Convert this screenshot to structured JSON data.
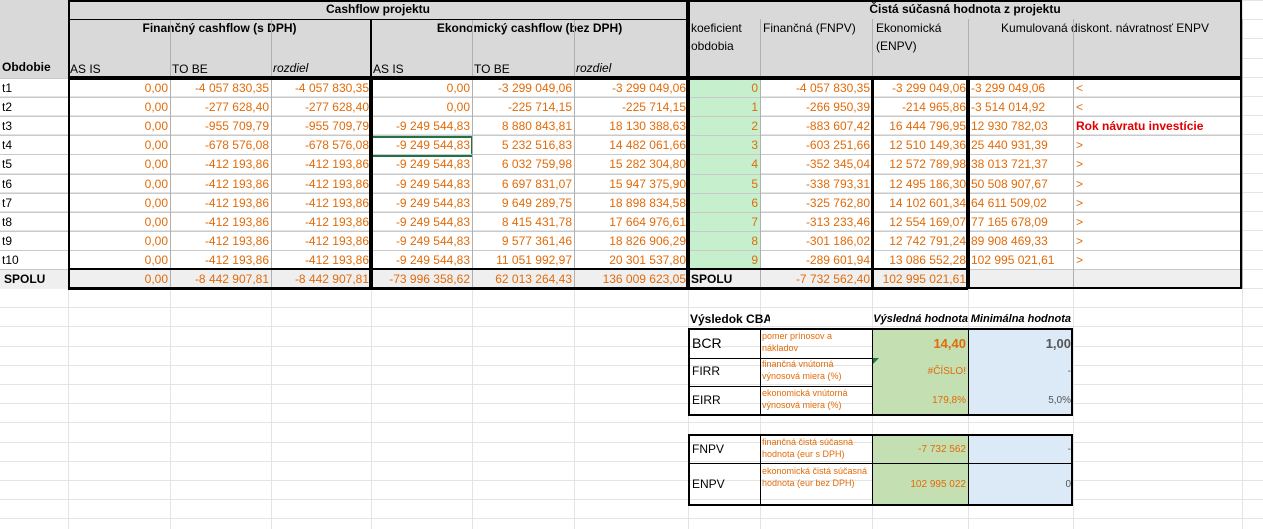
{
  "header": {
    "group_cashflow": "Cashflow projektu",
    "group_npv": "Čistá súčasná hodnota z projektu",
    "fin_cashflow": "Finančný cashflow (s DPH)",
    "eko_cashflow": "Ekonomický cashflow (bez DPH)",
    "koef": "koeficient obdobia",
    "fnpv": "Finančná (FNPV)",
    "enpv": "Ekonomická (ENPV)",
    "kum": "Kumulovaná diskont. návratnosť ENPV",
    "obdobie": "Obdobie",
    "as_is": "AS IS",
    "to_be": "TO BE",
    "rozdiel": "rozdiel"
  },
  "rows": [
    {
      "t": "t1",
      "fa": "0,00",
      "fb": "-4 057 830,35",
      "fr": "-4 057 830,35",
      "ea": "0,00",
      "eb": "-3 299 049,06",
      "er": "-3 299 049,06",
      "k": "0",
      "fnpv": "-4 057 830,35",
      "enpv": "-3 299 049,06",
      "kum": "-3 299 049,06",
      "note": "<"
    },
    {
      "t": "t2",
      "fa": "0,00",
      "fb": "-277 628,40",
      "fr": "-277 628,40",
      "ea": "0,00",
      "eb": "-225 714,15",
      "er": "-225 714,15",
      "k": "1",
      "fnpv": "-266 950,39",
      "enpv": "-214 965,86",
      "kum": "-3 514 014,92",
      "note": "<"
    },
    {
      "t": "t3",
      "fa": "0,00",
      "fb": "-955 709,79",
      "fr": "-955 709,79",
      "ea": "-9 249 544,83",
      "eb": "8 880 843,81",
      "er": "18 130 388,63",
      "k": "2",
      "fnpv": "-883 607,42",
      "enpv": "16 444 796,95",
      "kum": "12 930 782,03",
      "note": "Rok návratu investície"
    },
    {
      "t": "t4",
      "fa": "0,00",
      "fb": "-678 576,08",
      "fr": "-678 576,08",
      "ea": "-9 249 544,83",
      "eb": "5 232 516,83",
      "er": "14 482 061,66",
      "k": "3",
      "fnpv": "-603 251,66",
      "enpv": "12 510 149,36",
      "kum": "25 440 931,39",
      "note": ">"
    },
    {
      "t": "t5",
      "fa": "0,00",
      "fb": "-412 193,86",
      "fr": "-412 193,86",
      "ea": "-9 249 544,83",
      "eb": "6 032 759,98",
      "er": "15 282 304,80",
      "k": "4",
      "fnpv": "-352 345,04",
      "enpv": "12 572 789,98",
      "kum": "38 013 721,37",
      "note": ">"
    },
    {
      "t": "t6",
      "fa": "0,00",
      "fb": "-412 193,86",
      "fr": "-412 193,86",
      "ea": "-9 249 544,83",
      "eb": "6 697 831,07",
      "er": "15 947 375,90",
      "k": "5",
      "fnpv": "-338 793,31",
      "enpv": "12 495 186,30",
      "kum": "50 508 907,67",
      "note": ">"
    },
    {
      "t": "t7",
      "fa": "0,00",
      "fb": "-412 193,86",
      "fr": "-412 193,86",
      "ea": "-9 249 544,83",
      "eb": "9 649 289,75",
      "er": "18 898 834,58",
      "k": "6",
      "fnpv": "-325 762,80",
      "enpv": "14 102 601,34",
      "kum": "64 611 509,02",
      "note": ">"
    },
    {
      "t": "t8",
      "fa": "0,00",
      "fb": "-412 193,86",
      "fr": "-412 193,86",
      "ea": "-9 249 544,83",
      "eb": "8 415 431,78",
      "er": "17 664 976,61",
      "k": "7",
      "fnpv": "-313 233,46",
      "enpv": "12 554 169,07",
      "kum": "77 165 678,09",
      "note": ">"
    },
    {
      "t": "t9",
      "fa": "0,00",
      "fb": "-412 193,86",
      "fr": "-412 193,86",
      "ea": "-9 249 544,83",
      "eb": "9 577 361,46",
      "er": "18 826 906,29",
      "k": "8",
      "fnpv": "-301 186,02",
      "enpv": "12 742 791,24",
      "kum": "89 908 469,33",
      "note": ">"
    },
    {
      "t": "t10",
      "fa": "0,00",
      "fb": "-412 193,86",
      "fr": "-412 193,86",
      "ea": "-9 249 544,83",
      "eb": "11 051 992,97",
      "er": "20 301 537,80",
      "k": "9",
      "fnpv": "-289 601,94",
      "enpv": "13 086 552,28",
      "kum": "102 995 021,61",
      "note": ">"
    }
  ],
  "total": {
    "label": "SPOLU",
    "fa": "0,00",
    "fb": "-8 442 907,81",
    "fr": "-8 442 907,81",
    "ea": "-73 996 358,62",
    "eb": "62 013 264,43",
    "er": "136 009 623,05",
    "label2": "SPOLU",
    "fnpv": "-7 732 562,40",
    "enpv": "102 995 021,61"
  },
  "cba": {
    "title": "Výsledok CBA",
    "col_result": "Výsledná hodnota",
    "col_min": "Minimálna hodnota",
    "rows": [
      {
        "code": "BCR",
        "desc": "pomer prínosov a nákladov",
        "result": "14,40",
        "min": "1,00"
      },
      {
        "code": "FIRR",
        "desc": "finančná vnútorná výnosová miera (%)",
        "result": "#ČÍSLO!",
        "min": "-"
      },
      {
        "code": "EIRR",
        "desc": "ekonomická vnútorná výnosová miera (%)",
        "result": "179,8%",
        "min": "5,0%"
      }
    ],
    "npv_rows": [
      {
        "code": "FNPV",
        "desc": "finančná čistá súčasná hodnota (eur s DPH)",
        "result": "-7 732 562",
        "min": "-"
      },
      {
        "code": "ENPV",
        "desc": "ekonomická čistá súčasná hodnota (eur bez DPH)",
        "result": "102 995 022",
        "min": "0"
      }
    ]
  },
  "colors": {
    "orange": "#e26b0a",
    "red": "#e00000",
    "header_gray": "#d9d9d9",
    "koef_green": "#c6efce"
  }
}
